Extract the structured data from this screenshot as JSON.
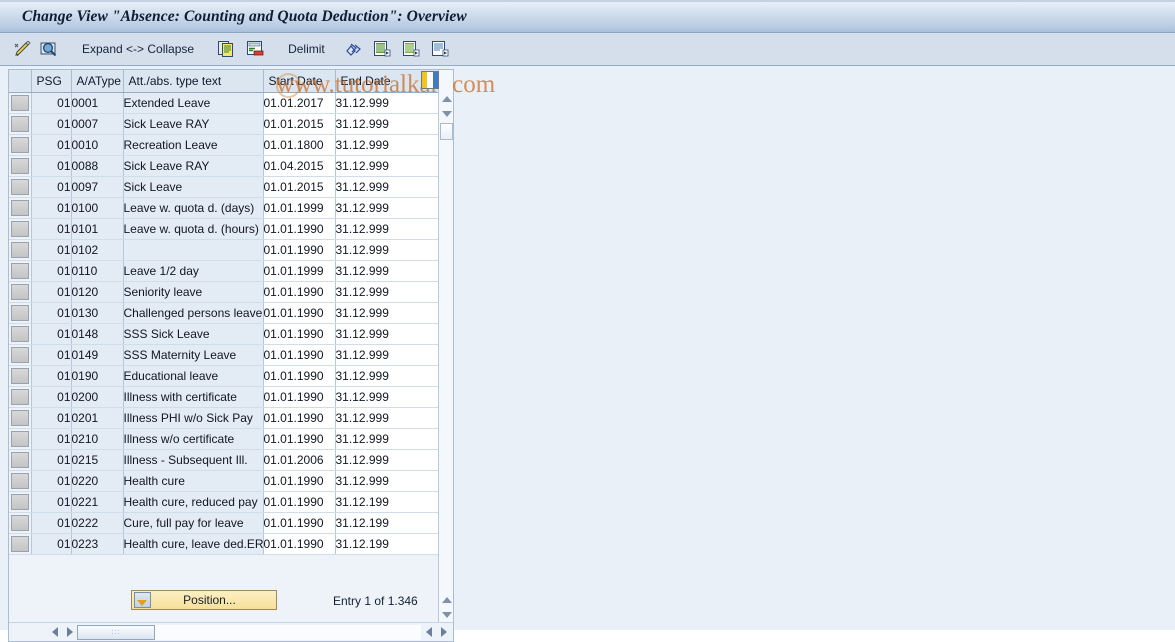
{
  "window": {
    "title": "Change View \"Absence: Counting and Quota Deduction\": Overview"
  },
  "watermark": {
    "text": "www.tutorialkart.com",
    "color": "#c8681e"
  },
  "toolbar": {
    "items": [
      {
        "type": "icon",
        "name": "display-change-icon",
        "label": "Display <-> Change"
      },
      {
        "type": "icon",
        "name": "check-entries-icon",
        "label": "Check Entries"
      },
      {
        "type": "text",
        "name": "expand-collapse-button",
        "label": "Expand <-> Collapse"
      },
      {
        "type": "icon",
        "name": "copy-as-icon",
        "label": "Copy As..."
      },
      {
        "type": "icon",
        "name": "delete-icon",
        "label": "Delete"
      },
      {
        "type": "text",
        "name": "delimit-button",
        "label": "Delimit"
      },
      {
        "type": "icon",
        "name": "select-all-icon",
        "label": "Select All"
      },
      {
        "type": "icon",
        "name": "previous-entry-icon",
        "label": "Previous Entry"
      },
      {
        "type": "icon",
        "name": "next-entry-icon",
        "label": "Next Entry"
      },
      {
        "type": "icon",
        "name": "details-icon",
        "label": "Details"
      }
    ]
  },
  "grid": {
    "columns": [
      {
        "key": "sel",
        "label": ""
      },
      {
        "key": "psg",
        "label": "PSG"
      },
      {
        "key": "type",
        "label": "A/AType"
      },
      {
        "key": "text",
        "label": "Att./abs. type text"
      },
      {
        "key": "start",
        "label": "Start Date"
      },
      {
        "key": "end",
        "label": "End Date"
      }
    ],
    "config_icon": "column-config-icon",
    "rows": [
      {
        "psg": "01",
        "type": "0001",
        "text": "Extended Leave",
        "start": "01.01.2017",
        "end": "31.12.999"
      },
      {
        "psg": "01",
        "type": "0007",
        "text": "Sick Leave RAY",
        "start": "01.01.2015",
        "end": "31.12.999"
      },
      {
        "psg": "01",
        "type": "0010",
        "text": "Recreation Leave",
        "start": "01.01.1800",
        "end": "31.12.999"
      },
      {
        "psg": "01",
        "type": "0088",
        "text": "Sick Leave RAY",
        "start": "01.04.2015",
        "end": "31.12.999"
      },
      {
        "psg": "01",
        "type": "0097",
        "text": "Sick Leave",
        "start": "01.01.2015",
        "end": "31.12.999"
      },
      {
        "psg": "01",
        "type": "0100",
        "text": "Leave w. quota d. (days)",
        "start": "01.01.1999",
        "end": "31.12.999"
      },
      {
        "psg": "01",
        "type": "0101",
        "text": "Leave w. quota d. (hours)",
        "start": "01.01.1990",
        "end": "31.12.999"
      },
      {
        "psg": "01",
        "type": "0102",
        "text": "",
        "start": "01.01.1990",
        "end": "31.12.999"
      },
      {
        "psg": "01",
        "type": "0110",
        "text": "Leave 1/2 day",
        "start": "01.01.1999",
        "end": "31.12.999"
      },
      {
        "psg": "01",
        "type": "0120",
        "text": "Seniority leave",
        "start": "01.01.1990",
        "end": "31.12.999"
      },
      {
        "psg": "01",
        "type": "0130",
        "text": "Challenged persons leave",
        "start": "01.01.1990",
        "end": "31.12.999"
      },
      {
        "psg": "01",
        "type": "0148",
        "text": "SSS Sick Leave",
        "start": "01.01.1990",
        "end": "31.12.999"
      },
      {
        "psg": "01",
        "type": "0149",
        "text": "SSS Maternity Leave",
        "start": "01.01.1990",
        "end": "31.12.999"
      },
      {
        "psg": "01",
        "type": "0190",
        "text": "Educational leave",
        "start": "01.01.1990",
        "end": "31.12.999"
      },
      {
        "psg": "01",
        "type": "0200",
        "text": "Illness with certificate",
        "start": "01.01.1990",
        "end": "31.12.999"
      },
      {
        "psg": "01",
        "type": "0201",
        "text": "Illness PHI w/o Sick Pay",
        "start": "01.01.1990",
        "end": "31.12.999"
      },
      {
        "psg": "01",
        "type": "0210",
        "text": "Illness w/o certificate",
        "start": "01.01.1990",
        "end": "31.12.999"
      },
      {
        "psg": "01",
        "type": "0215",
        "text": "Illness - Subsequent Ill.",
        "start": "01.01.2006",
        "end": "31.12.999"
      },
      {
        "psg": "01",
        "type": "0220",
        "text": "Health cure",
        "start": "01.01.1990",
        "end": "31.12.999"
      },
      {
        "psg": "01",
        "type": "0221",
        "text": "Health cure, reduced pay",
        "start": "01.01.1990",
        "end": "31.12.199"
      },
      {
        "psg": "01",
        "type": "0222",
        "text": "Cure, full pay for leave",
        "start": "01.01.1990",
        "end": "31.12.199"
      },
      {
        "psg": "01",
        "type": "0223",
        "text": "Health cure, leave ded.ER",
        "start": "01.01.1990",
        "end": "31.12.199"
      }
    ]
  },
  "footer": {
    "position_button": "Position...",
    "entry_info": "Entry 1 of 1.346"
  }
}
